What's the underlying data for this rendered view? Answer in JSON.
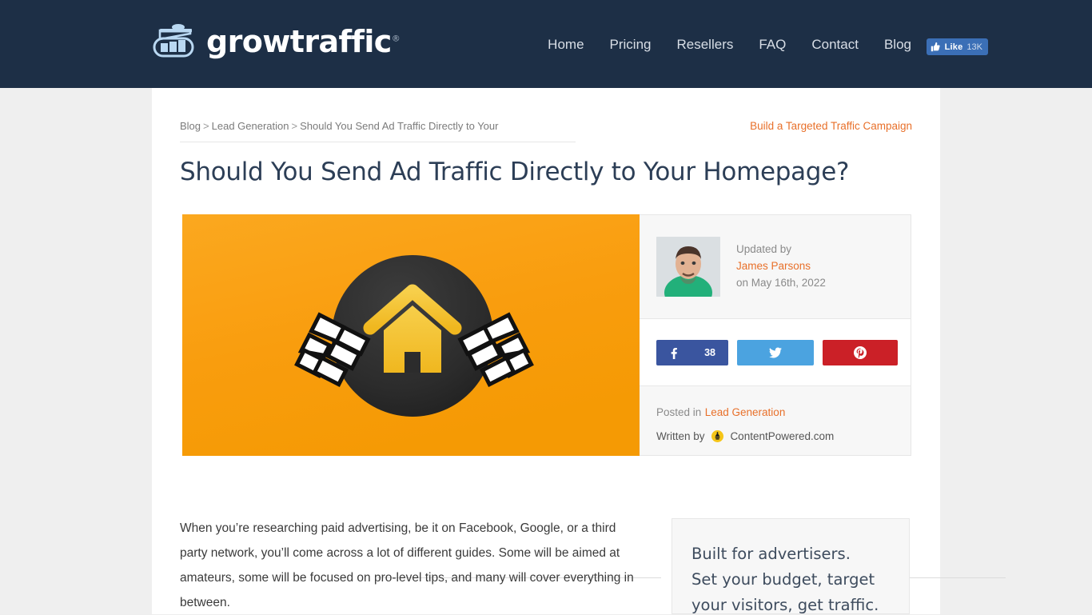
{
  "header": {
    "brand_name": "growtraffic",
    "brand_registered": "®",
    "brand_icon": "growtraffic-logo-icon",
    "nav_items": [
      {
        "label": "Home"
      },
      {
        "label": "Pricing"
      },
      {
        "label": "Resellers"
      },
      {
        "label": "FAQ"
      },
      {
        "label": "Contact"
      },
      {
        "label": "Blog"
      }
    ],
    "facebook_like": {
      "icon": "thumbs-up-icon",
      "label": "Like",
      "count": "13K"
    },
    "bg_color": "#1d2f46"
  },
  "breadcrumb": {
    "items": [
      {
        "label": "Blog"
      },
      {
        "label": "Lead Generation"
      },
      {
        "label": "Should You Send Ad Traffic Directly to Your"
      }
    ],
    "separator": ">"
  },
  "top_cta": {
    "label": "Build a Targeted Traffic Campaign",
    "color": "#e8702a"
  },
  "article": {
    "title": "Should You Send Ad Traffic Directly to Your Homepage?",
    "hero": {
      "alt": "Orange banner with dark circle, yellow house icon and two pixel cursor hands",
      "background_color": "#f99d10",
      "circle_color": "#2e2e2e",
      "house_color": "#f5c53a"
    },
    "paragraphs": [
      "When you’re researching paid advertising, be it on Facebook, Google, or a third party network, you’ll come across a lot of different guides. Some will be aimed at amateurs, some will be focused on pro-level tips, and many will cover everything in between."
    ]
  },
  "author_card": {
    "avatar_alt": "James Parsons headshot",
    "updated_label": "Updated by",
    "author_name": "James Parsons",
    "date_label": "on May 16th, 2022",
    "share_buttons": [
      {
        "network": "facebook",
        "icon": "facebook-icon",
        "count": "38",
        "color": "#3a559f"
      },
      {
        "network": "twitter",
        "icon": "twitter-icon",
        "count": "",
        "color": "#4ba3e0"
      },
      {
        "network": "pinterest",
        "icon": "pinterest-icon",
        "count": "",
        "color": "#cb2027"
      }
    ],
    "posted_in_label": "Posted in",
    "posted_in_category": "Lead Generation",
    "written_by_label": "Written by",
    "written_by_badge": "contentpowered-badge-icon",
    "written_by_name": "ContentPowered.com"
  },
  "divider": {
    "ornament": "flourish-ornament-icon"
  },
  "promo": {
    "lines": [
      "Built for advertisers.",
      "Set your budget, target",
      "your visitors, get traffic."
    ]
  }
}
